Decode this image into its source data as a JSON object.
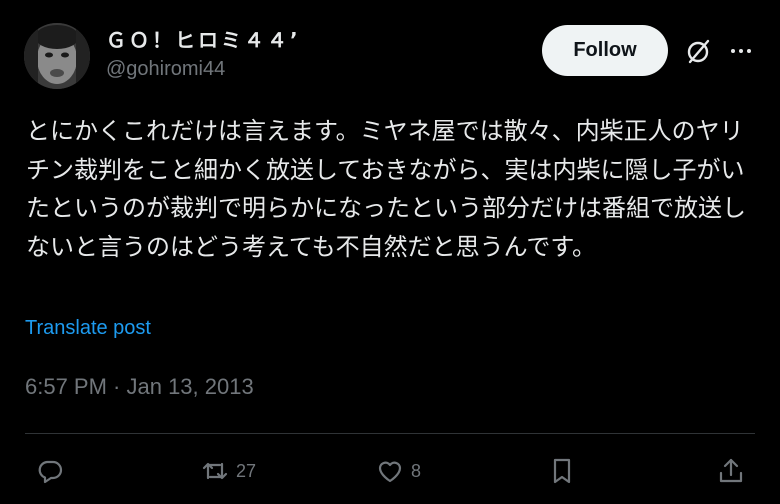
{
  "author": {
    "display_name": "ＧＯ！ヒロミ４４’",
    "handle": "@gohiromi44"
  },
  "header": {
    "follow_label": "Follow"
  },
  "post": {
    "text": "とにかくこれだけは言えます。ミヤネ屋では散々、内柴正人のヤリチン裁判をこと細かく放送しておきながら、実は内柴に隠し子がいたというのが裁判で明らかになったという部分だけは番組で放送しないと言うのはどう考えても不自然だと思うんです。",
    "translate_label": "Translate post",
    "timestamp": "6:57 PM · Jan 13, 2013"
  },
  "actions": {
    "reposts": "27",
    "likes": "8"
  },
  "colors": {
    "background": "#000000",
    "text": "#e7e9ea",
    "muted": "#71767b",
    "link": "#1d9bf0",
    "follow_bg": "#eff3f4"
  }
}
